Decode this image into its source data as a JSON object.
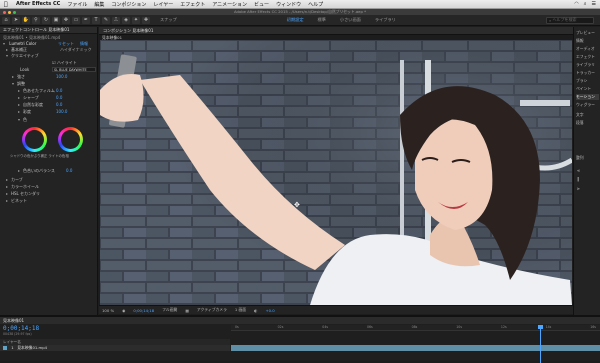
{
  "menubar": {
    "apple": "",
    "app": "After Effects CC",
    "items": [
      "ファイル",
      "編集",
      "コンポジション",
      "レイヤー",
      "エフェクト",
      "アニメーション",
      "ビュー",
      "ウィンドウ",
      "ヘルプ"
    ]
  },
  "window": {
    "title": "Adobe After Effects CC 2015 - /Users/n.t/Desktop/自然プリセット.aep *"
  },
  "toolbar": {
    "snap_label": "スナップ",
    "workspaces": [
      "初期設定",
      "標準",
      "小さい画面",
      "ライブラリ"
    ],
    "active_workspace": "初期設定",
    "search_placeholder": "ヘルプを検索"
  },
  "effects_panel": {
    "tab_label": "エフェクトコントロール 見本映像01",
    "layer_line": "見本映像01 • 見本映像01.mp4",
    "effect_name": "Lumetri Color",
    "reset_label": "リセット",
    "about_label": "情報",
    "rows": [
      {
        "label": "基本補正",
        "value": ""
      },
      {
        "label": "クリエイティブ",
        "value": ""
      },
      {
        "label": "Look",
        "value": "SL BLUE DAYWHITE"
      },
      {
        "label": "強さ",
        "value": "100.0"
      },
      {
        "label": "調整",
        "value": ""
      },
      {
        "label": "色あせたフィルム",
        "value": "0.0"
      },
      {
        "label": "シャープ",
        "value": "0.0"
      },
      {
        "label": "自然な彩度",
        "value": "0.0"
      },
      {
        "label": "彩度",
        "value": "100.0"
      },
      {
        "label": "色",
        "value": ""
      },
      {
        "label": "カーブ",
        "value": ""
      },
      {
        "label": "カラーホイール",
        "value": ""
      },
      {
        "label": "HSL セカンダリ",
        "value": ""
      },
      {
        "label": "ビネット",
        "value": ""
      }
    ],
    "wheels_caption": "シャドウの色かぶり補正  ライトの色相",
    "tint_balance_label": "色合いのバランス",
    "tint_balance_value": "0.0",
    "highlight_label": "ハイダイナミック",
    "checkbox_label": "ハイライト"
  },
  "comp": {
    "tab_label": "コンポジション 見本映像01",
    "sub_label": "見本映像01",
    "zoom": "100 %",
    "timecode": "0;00;14;18",
    "quality": "フル画質",
    "camera": "アクティブカメラ",
    "view": "1 画面",
    "exposure": "+0.0"
  },
  "right_panel": {
    "items": [
      "プレビュー",
      "情報",
      "オーディオ",
      "エフェクト",
      "ライブラリ",
      "トラッカー",
      "ブラシ",
      "ペイント",
      "モーション",
      "ウィグラー",
      "文字",
      "段落",
      "整列"
    ],
    "selected": "モーション"
  },
  "timeline": {
    "tab_label": "見本映像01",
    "time": "0;00;14;18",
    "fps": "00438 (29.97 fps)",
    "col_header": "レイヤー名",
    "layer_number": "1",
    "layer_name": "見本映像01.mp4",
    "ruler": [
      "0s",
      "02s",
      "04s",
      "06s",
      "08s",
      "10s",
      "12s",
      "14s",
      "16s"
    ]
  },
  "colors": {
    "accent": "#4da6ff",
    "layer_bar": "#5f8fa6"
  }
}
